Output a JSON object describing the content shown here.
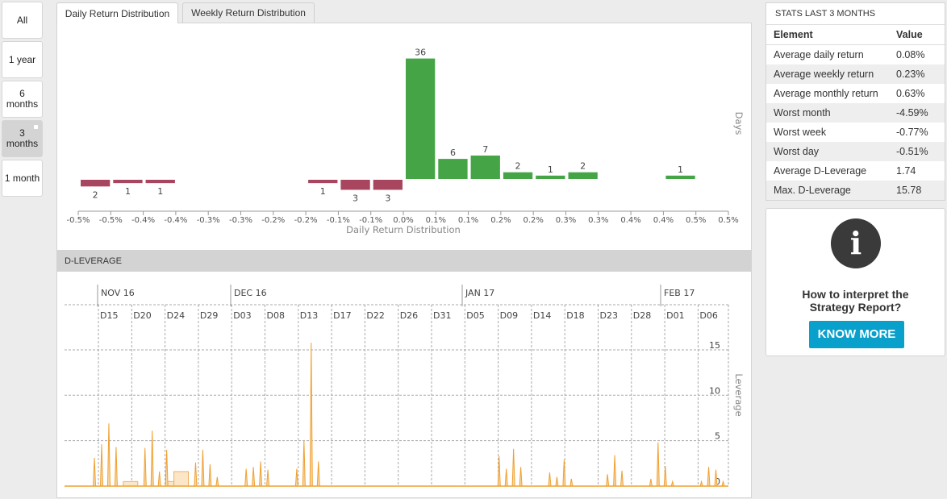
{
  "range_buttons": [
    {
      "label": "All",
      "active": false
    },
    {
      "label": "1 year",
      "active": false
    },
    {
      "label": "6 months",
      "active": false
    },
    {
      "label": "3 months",
      "active": true
    },
    {
      "label": "1 month",
      "active": false
    }
  ],
  "tabs": [
    {
      "label": "Daily Return Distribution",
      "active": true
    },
    {
      "label": "Weekly Return Distribution",
      "active": false
    }
  ],
  "leverage_section_title": "D-LEVERAGE",
  "stats": {
    "title": "STATS LAST 3 MONTHS",
    "headers": [
      "Element",
      "Value"
    ],
    "rows": [
      [
        "Average daily return",
        "0.08%"
      ],
      [
        "Average weekly return",
        "0.23%"
      ],
      [
        "Average monthly return",
        "0.63%"
      ],
      [
        "Worst month",
        "-4.59%"
      ],
      [
        "Worst week",
        "-0.77%"
      ],
      [
        "Worst day",
        "-0.51%"
      ],
      [
        "Average D-Leverage",
        "1.74"
      ],
      [
        "Max. D-Leverage",
        "15.78"
      ]
    ]
  },
  "info": {
    "icon": "info-icon",
    "question": "How to interpret the Strategy Report?",
    "button": "KNOW MORE",
    "button_color": "#0aa0cc"
  },
  "chart_data": [
    {
      "type": "bar",
      "xlabel": "Daily Return Distribution",
      "ylabel": "Days",
      "tick_labels": [
        "-0.5%",
        "-0.5%",
        "-0.4%",
        "-0.4%",
        "-0.3%",
        "-0.3%",
        "-0.2%",
        "-0.2%",
        "-0.1%",
        "-0.1%",
        "0.0%",
        "0.1%",
        "0.1%",
        "0.2%",
        "0.2%",
        "0.3%",
        "0.3%",
        "0.4%",
        "0.4%",
        "0.5%",
        "0.5%"
      ],
      "values": [
        -2,
        -1,
        -1,
        0,
        0,
        0,
        0,
        -1,
        -3,
        -3,
        36,
        6,
        7,
        2,
        1,
        2,
        0,
        0,
        1,
        0
      ],
      "colors": {
        "positive": "#45a546",
        "negative": "#a8465f"
      },
      "grid": false
    },
    {
      "type": "area",
      "ylabel": "Leverage",
      "yticks": [
        0,
        5,
        10,
        15
      ],
      "ylim": [
        0,
        17
      ],
      "month_labels": [
        {
          "label": "NOV 16",
          "date": "2016-11-15"
        },
        {
          "label": "DEC 16",
          "date": "2016-12-03"
        },
        {
          "label": "JAN 17",
          "date": "2017-01-05"
        },
        {
          "label": "FEB 17",
          "date": "2017-02-01"
        }
      ],
      "day_labels": [
        "D15",
        "D20",
        "D24",
        "D29",
        "D03",
        "D08",
        "D13",
        "D17",
        "D22",
        "D26",
        "D31",
        "D05",
        "D09",
        "D14",
        "D18",
        "D23",
        "D28",
        "D01",
        "D06"
      ],
      "color": "#f0a030",
      "grid": true,
      "points": [
        [
          "2016-11-14",
          3.1
        ],
        [
          "2016-11-15",
          4.6
        ],
        [
          "2016-11-16",
          6.9
        ],
        [
          "2016-11-17",
          4.3
        ],
        [
          "2016-11-21",
          4.2
        ],
        [
          "2016-11-22",
          6.1
        ],
        [
          "2016-11-23",
          1.6
        ],
        [
          "2016-11-24",
          4.0
        ],
        [
          "2016-11-28",
          2.6
        ],
        [
          "2016-11-29",
          4.0
        ],
        [
          "2016-11-30",
          2.4
        ],
        [
          "2016-12-01",
          1.0
        ],
        [
          "2016-12-05",
          1.9
        ],
        [
          "2016-12-06",
          2.1
        ],
        [
          "2016-12-07",
          2.7
        ],
        [
          "2016-12-08",
          1.8
        ],
        [
          "2016-12-12",
          1.9
        ],
        [
          "2016-12-13",
          5.0
        ],
        [
          "2016-12-14",
          15.78
        ],
        [
          "2016-12-15",
          2.7
        ],
        [
          "2017-01-09",
          3.3
        ],
        [
          "2017-01-10",
          1.9
        ],
        [
          "2017-01-11",
          4.1
        ],
        [
          "2017-01-12",
          2.1
        ],
        [
          "2017-01-16",
          1.5
        ],
        [
          "2017-01-17",
          1.0
        ],
        [
          "2017-01-18",
          2.9
        ],
        [
          "2017-01-19",
          0.8
        ],
        [
          "2017-01-24",
          1.3
        ],
        [
          "2017-01-25",
          3.4
        ],
        [
          "2017-01-26",
          1.7
        ],
        [
          "2017-01-30",
          0.8
        ],
        [
          "2017-01-31",
          4.8
        ],
        [
          "2017-02-01",
          2.2
        ],
        [
          "2017-02-02",
          0.5
        ],
        [
          "2017-02-06",
          0.5
        ],
        [
          "2017-02-07",
          2.1
        ],
        [
          "2017-02-08",
          1.8
        ],
        [
          "2017-02-09",
          0.5
        ]
      ],
      "plateaus": [
        [
          "2016-11-18",
          "2016-11-20",
          0.5
        ],
        [
          "2016-11-24",
          "2016-11-25",
          0.5
        ],
        [
          "2016-11-25",
          "2016-11-27",
          1.6
        ]
      ]
    }
  ]
}
